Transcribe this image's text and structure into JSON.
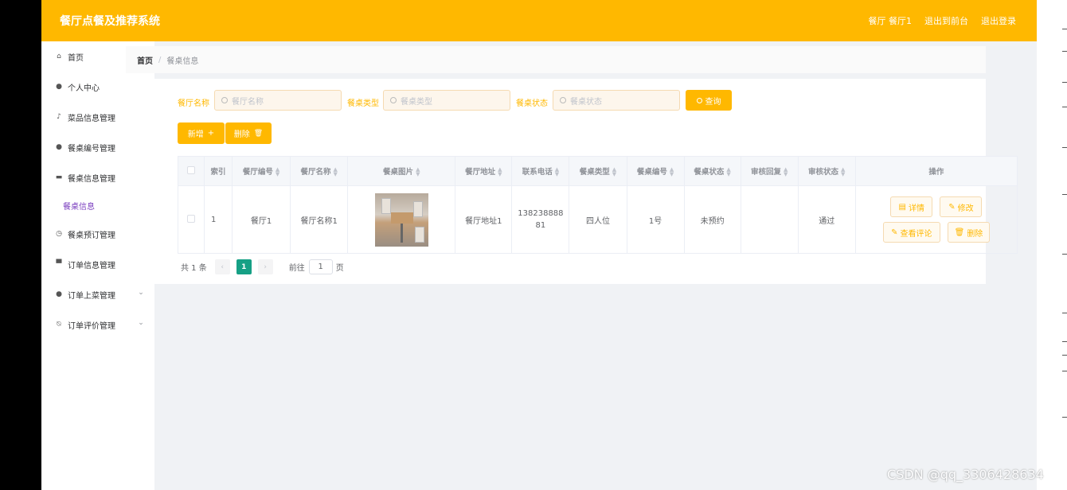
{
  "header": {
    "title": "餐厅点餐及推荐系统",
    "user": "餐厅 餐厅1",
    "to_front": "退出到前台",
    "logout": "退出登录"
  },
  "sidebar": {
    "items": [
      {
        "label": "首页",
        "icon": "home-icon"
      },
      {
        "label": "个人中心",
        "icon": "user-icon"
      },
      {
        "label": "菜品信息管理",
        "icon": "mic-icon"
      },
      {
        "label": "餐桌编号管理",
        "icon": "location-icon"
      },
      {
        "label": "餐桌信息管理",
        "icon": "chat-icon"
      },
      {
        "label": "餐桌预订管理",
        "icon": "clock-icon"
      },
      {
        "label": "订单信息管理",
        "icon": "monitor-icon"
      },
      {
        "label": "订单上菜管理",
        "icon": "person-icon"
      },
      {
        "label": "订单评价管理",
        "icon": "bell-off-icon"
      }
    ],
    "sub_active": "餐桌信息"
  },
  "breadcrumb": {
    "home": "首页",
    "separator": "/",
    "current": "餐桌信息"
  },
  "filters": {
    "name_label": "餐厅名称",
    "name_placeholder": "餐厅名称",
    "type_label": "餐桌类型",
    "type_placeholder": "餐桌类型",
    "status_label": "餐桌状态",
    "status_placeholder": "餐桌状态",
    "query": "查询"
  },
  "actions": {
    "add": "新增",
    "delete": "删除"
  },
  "table": {
    "headers": [
      "索引",
      "餐厅编号",
      "餐厅名称",
      "餐桌图片",
      "餐厅地址",
      "联系电话",
      "餐桌类型",
      "餐桌编号",
      "餐桌状态",
      "审核回复",
      "审核状态",
      "操作"
    ],
    "rows": [
      {
        "index": "1",
        "code": "餐厅1",
        "name": "餐厅名称1",
        "address": "餐厅地址1",
        "phone": "13823888881",
        "type": "四人位",
        "table_no": "1号",
        "status": "未预约",
        "reply": "",
        "audit": "通过"
      }
    ],
    "ops": {
      "detail": "详情",
      "edit": "修改",
      "reviews": "查看评论",
      "delete": "删除"
    }
  },
  "pagination": {
    "total": "共 1 条",
    "page": "1",
    "goto_prefix": "前往",
    "goto_value": "1",
    "goto_suffix": "页"
  },
  "watermark": "CSDN @qq_3306428634",
  "colors": {
    "accent": "#ffb800",
    "page_active": "#16a085",
    "submenu": "#7b3fbf"
  }
}
